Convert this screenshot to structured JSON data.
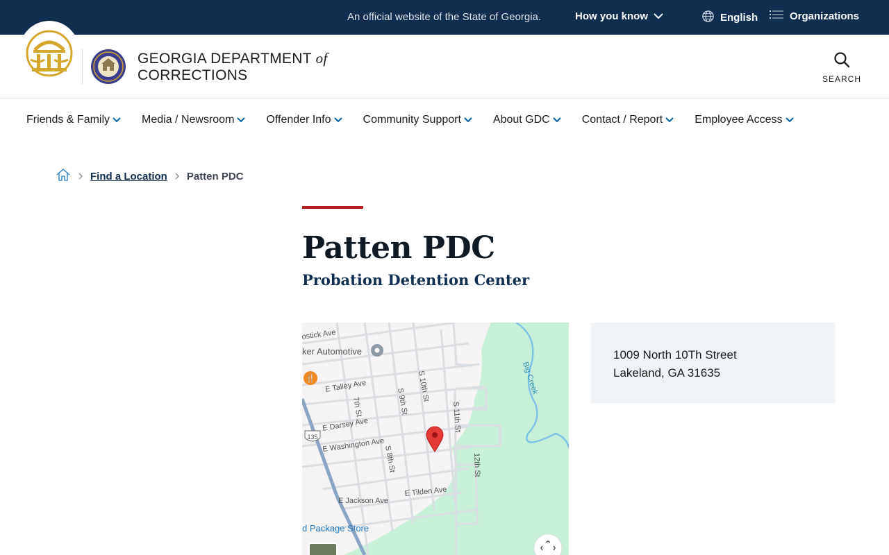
{
  "banner": {
    "official_text": "An official website of the State of Georgia.",
    "how_you_know": "How you know",
    "language": "English",
    "organizations": "Organizations"
  },
  "header": {
    "agency_line1": "GEORGIA DEPARTMENT",
    "agency_of": "of",
    "agency_line2": "CORRECTIONS",
    "search_label": "SEARCH"
  },
  "nav": [
    {
      "label": "Friends & Family"
    },
    {
      "label": "Media / Newsroom"
    },
    {
      "label": "Offender Info"
    },
    {
      "label": "Community Support"
    },
    {
      "label": "About GDC"
    },
    {
      "label": "Contact / Report"
    },
    {
      "label": "Employee Access"
    }
  ],
  "breadcrumb": {
    "link": "Find a Location",
    "current": "Patten PDC"
  },
  "page": {
    "title": "Patten PDC",
    "subtitle": "Probation Detention Center"
  },
  "address": {
    "line1": "1009 North 10Th Street",
    "line2": "Lakeland, GA 31635"
  },
  "map": {
    "labels": {
      "bostick": "ostick Ave",
      "automotive": "ker Automotive",
      "talley": "E Talley Ave",
      "seventh": "7th St",
      "ninth": "S 9th St",
      "tenth": "S 10th St",
      "eleventh": "S 11th St",
      "darsey": "E Darsey Ave",
      "washington": "E Washington Ave",
      "eighth": "S 8th St",
      "twelfth": "12th St",
      "tilden": "E Tilden Ave",
      "jackson": "E Jackson Ave",
      "package": "d Package Store",
      "creek": "Big Creek",
      "route": "135"
    }
  },
  "colors": {
    "banner_bg": "#112e51",
    "accent_red": "#b31e1e",
    "link_blue": "#005ea2",
    "address_bg": "#f1f4f7",
    "park_green": "#c8f0d8"
  }
}
